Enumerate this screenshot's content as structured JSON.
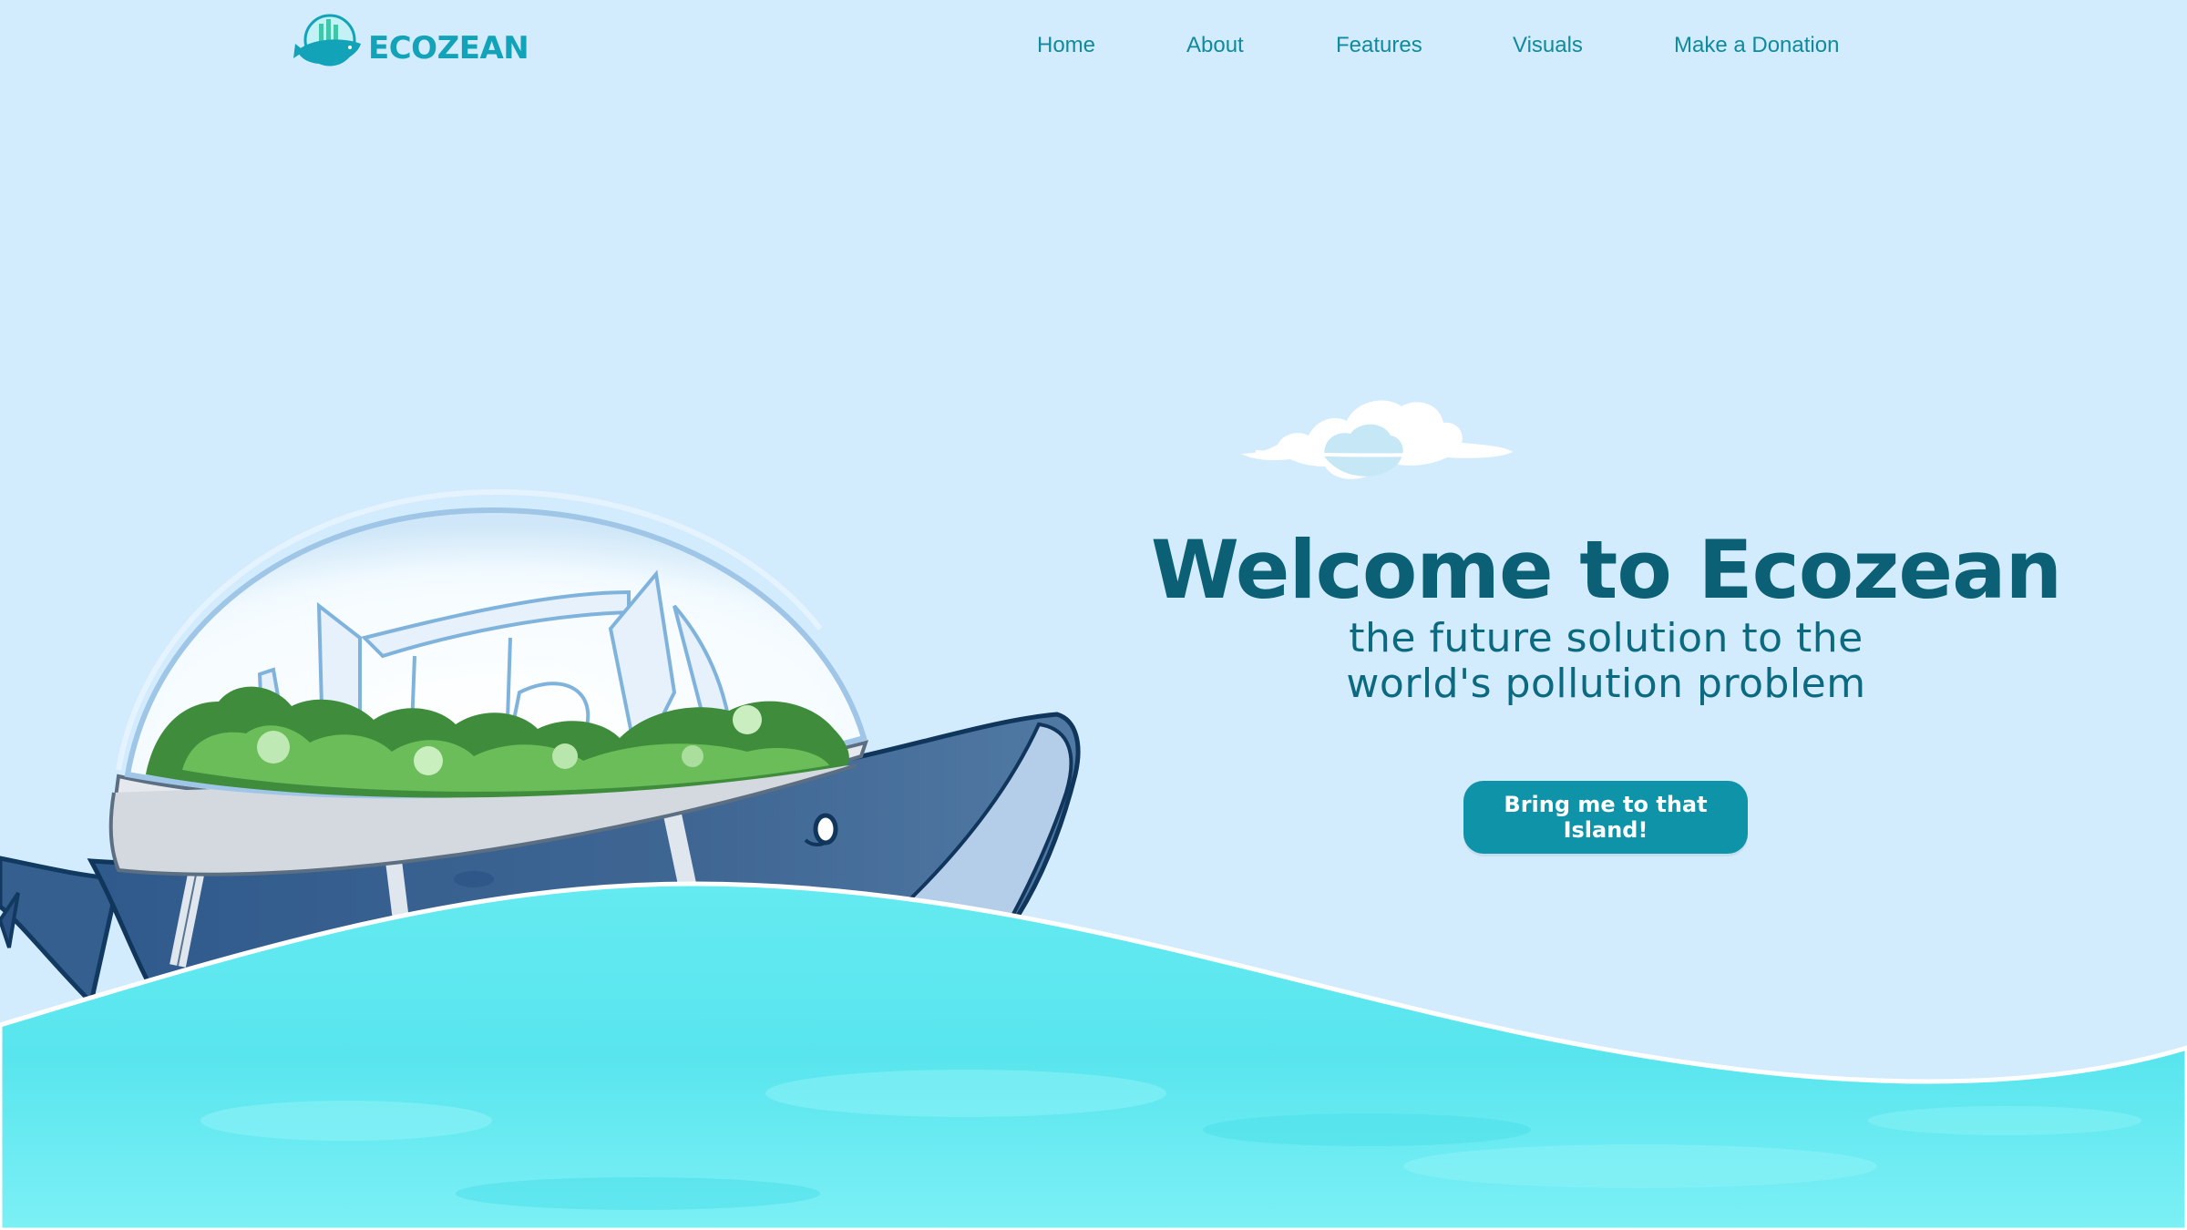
{
  "brand": {
    "name": "ECOZEAN",
    "logo_icon": "whale-dome-logo-icon"
  },
  "nav": {
    "items": [
      {
        "label": "Home"
      },
      {
        "label": "About"
      },
      {
        "label": "Features"
      },
      {
        "label": "Visuals"
      },
      {
        "label": "Make a Donation"
      }
    ]
  },
  "hero": {
    "title": "Welcome to Ecozean",
    "subtitle_line1": "the future solution to the",
    "subtitle_line2": "world's pollution problem",
    "cta_label": "Bring me to that Island!"
  },
  "illustration": {
    "subject": "whale-with-dome-city-illustration",
    "cloud_icon": "cloud-icon",
    "waves": "ocean-waves"
  },
  "colors": {
    "background": "#d2ecfd",
    "brand_teal": "#13a3b8",
    "title": "#0b6076",
    "cta": "#0e93a9",
    "whale": "#3e6591",
    "water": "#55e6ef"
  }
}
